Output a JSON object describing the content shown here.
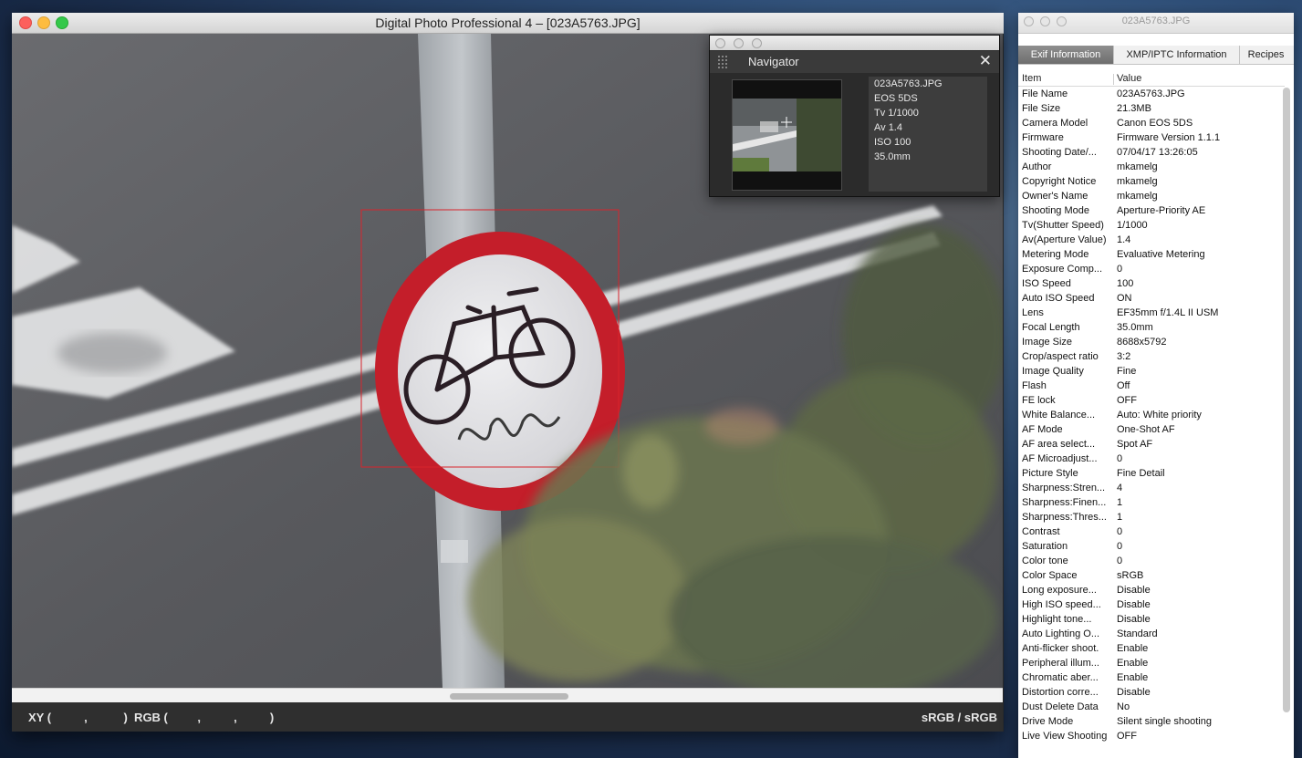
{
  "main_window": {
    "title": "Digital Photo Professional 4 – [023A5763.JPG]",
    "status_left": "XY (          ,           )  RGB (         ,          ,          )",
    "status_right": "sRGB / sRGB"
  },
  "navigator": {
    "title": "Navigator",
    "close_icon": "✕",
    "info": [
      "023A5763.JPG",
      "EOS 5DS",
      "Tv 1/1000",
      "Av 1.4",
      "ISO 100",
      "35.0mm"
    ]
  },
  "info_panel": {
    "title": "023A5763.JPG",
    "tabs": [
      "Exif Information",
      "XMP/IPTC Information",
      "Recipes"
    ],
    "active_tab": 0,
    "columns": [
      "Item",
      "Value"
    ],
    "rows": [
      [
        "File Name",
        "023A5763.JPG"
      ],
      [
        "File Size",
        "21.3MB"
      ],
      [
        "Camera Model",
        "Canon EOS 5DS"
      ],
      [
        "Firmware",
        "Firmware Version 1.1.1"
      ],
      [
        "Shooting Date/...",
        "07/04/17 13:26:05"
      ],
      [
        "Author",
        "mkamelg"
      ],
      [
        "Copyright Notice",
        "mkamelg"
      ],
      [
        "Owner's Name",
        "mkamelg"
      ],
      [
        "Shooting Mode",
        "Aperture-Priority AE"
      ],
      [
        "Tv(Shutter Speed)",
        "1/1000"
      ],
      [
        "Av(Aperture Value)",
        "1.4"
      ],
      [
        "Metering Mode",
        "Evaluative Metering"
      ],
      [
        "Exposure Comp...",
        "0"
      ],
      [
        "ISO Speed",
        "100"
      ],
      [
        "Auto ISO Speed",
        "ON"
      ],
      [
        "Lens",
        "EF35mm f/1.4L II USM"
      ],
      [
        "Focal Length",
        "35.0mm"
      ],
      [
        "Image Size",
        "8688x5792"
      ],
      [
        "Crop/aspect ratio",
        "3:2"
      ],
      [
        "Image Quality",
        "Fine"
      ],
      [
        "Flash",
        "Off"
      ],
      [
        "FE lock",
        "OFF"
      ],
      [
        "White Balance...",
        "Auto: White priority"
      ],
      [
        "AF Mode",
        "One-Shot AF"
      ],
      [
        "AF area select...",
        "Spot AF"
      ],
      [
        "AF Microadjust...",
        "0"
      ],
      [
        "Picture Style",
        "Fine Detail"
      ],
      [
        "Sharpness:Stren...",
        "4"
      ],
      [
        "Sharpness:Finen...",
        "1"
      ],
      [
        "Sharpness:Thres...",
        "1"
      ],
      [
        "Contrast",
        "0"
      ],
      [
        "Saturation",
        "0"
      ],
      [
        "Color tone",
        "0"
      ],
      [
        "Color Space",
        "sRGB"
      ],
      [
        "Long exposure...",
        "Disable"
      ],
      [
        "High ISO speed...",
        "Disable"
      ],
      [
        "Highlight tone...",
        "Disable"
      ],
      [
        "Auto Lighting O...",
        "Standard"
      ],
      [
        "Anti-flicker shoot.",
        "Enable"
      ],
      [
        "Peripheral illum...",
        "Enable"
      ],
      [
        "Chromatic aber...",
        "Enable"
      ],
      [
        "Distortion corre...",
        "Disable"
      ],
      [
        "Dust Delete Data",
        "No"
      ],
      [
        "Drive Mode",
        "Silent single shooting"
      ],
      [
        "Live View Shooting",
        "OFF"
      ]
    ]
  },
  "colors": {
    "accent_red": "#d8242c",
    "tab_active": "#7a7a7a"
  }
}
